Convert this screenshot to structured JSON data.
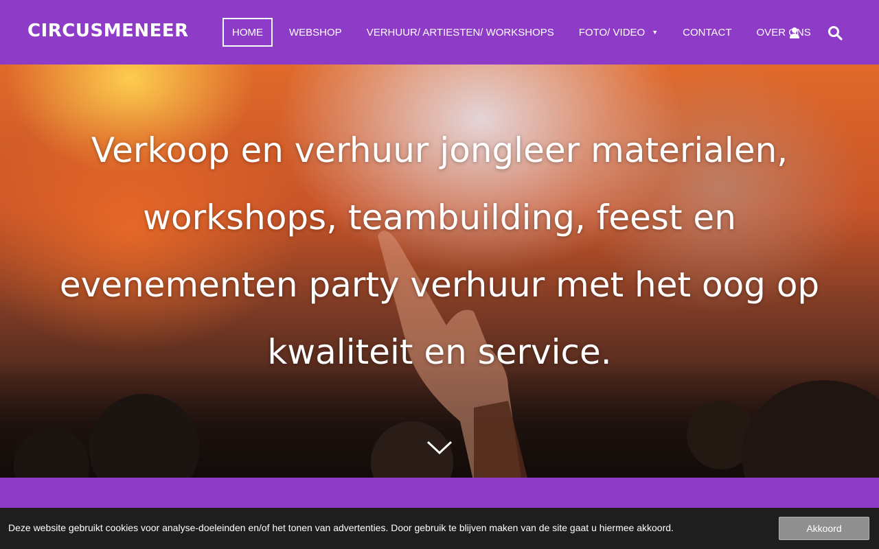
{
  "site": {
    "logo": "CIRCUSMENEER"
  },
  "nav": {
    "items": [
      {
        "label": "HOME"
      },
      {
        "label": "WEBSHOP"
      },
      {
        "label": "VERHUUR/ ARTIESTEN/ WORKSHOPS"
      },
      {
        "label": "FOTO/ VIDEO",
        "caret": "▼"
      },
      {
        "label": "CONTACT"
      },
      {
        "label": "OVER ONS"
      }
    ],
    "active_index": 0,
    "icons": [
      "user-icon",
      "search-icon"
    ]
  },
  "hero": {
    "title": "Verkoop en verhuur jongleer materialen, workshops, teambuilding, feest en evenementen party verhuur met het oog op kwaliteit en service.",
    "scroll_icon": "chevron-down-icon"
  },
  "cookie": {
    "text": "Deze website gebruikt cookies voor analyse-doeleinden en/of het tonen van advertenties. Door gebruik te blijven maken van de site gaat u hiermee akkoord.",
    "button": "Akkoord"
  },
  "colors": {
    "brand_purple": "#8e3bc7",
    "cookie_bar": "#1e1e1e",
    "cookie_button": "#8f8f8f"
  }
}
